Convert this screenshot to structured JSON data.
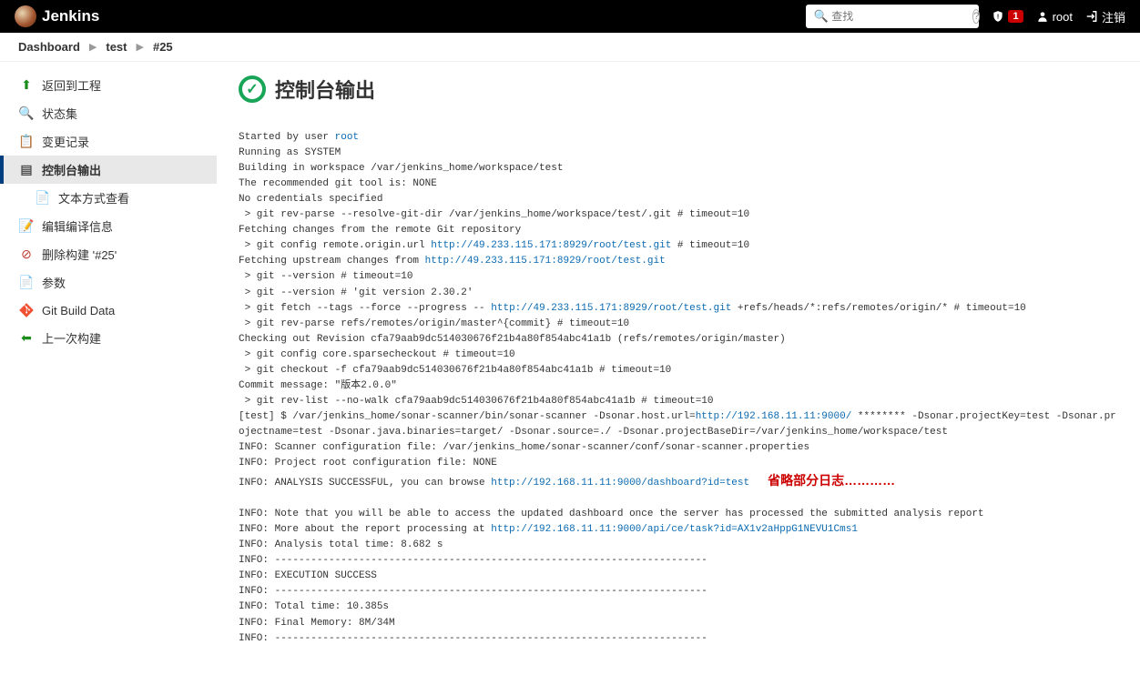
{
  "header": {
    "brand": "Jenkins",
    "searchPlaceholder": "查找",
    "alertCount": "1",
    "user": "root",
    "logoutLabel": "注销"
  },
  "breadcrumb": {
    "items": [
      "Dashboard",
      "test",
      "#25"
    ]
  },
  "sidebar": {
    "items": [
      {
        "key": "back",
        "label": "返回到工程"
      },
      {
        "key": "status",
        "label": "状态集"
      },
      {
        "key": "changes",
        "label": "变更记录"
      },
      {
        "key": "console",
        "label": "控制台输出"
      },
      {
        "key": "plaintext",
        "label": "文本方式查看"
      },
      {
        "key": "editinfo",
        "label": "编辑编译信息"
      },
      {
        "key": "delete",
        "label": "删除构建 '#25'"
      },
      {
        "key": "params",
        "label": "参数"
      },
      {
        "key": "git",
        "label": "Git Build Data"
      },
      {
        "key": "prev",
        "label": "上一次构建"
      }
    ]
  },
  "page": {
    "title": "控制台输出"
  },
  "links": {
    "user": "root",
    "url1": "http://49.233.115.171:8929/root/test.git",
    "url2": "http://49.233.115.171:8929/root/test.git",
    "url3": "http://49.233.115.171:8929/root/test.git",
    "sonarHost": "http://192.168.11.11:9000/",
    "dash": "http://192.168.11.11:9000/dashboard?id=test",
    "task": "http://192.168.11.11:9000/api/ce/task?id=AX1v2aHppG1NEVU1Cms1"
  },
  "annotation": "省略部分日志…………",
  "console": {
    "l01": "Started by user ",
    "l02": "Running as SYSTEM",
    "l03": "Building in workspace /var/jenkins_home/workspace/test",
    "l04": "The recommended git tool is: NONE",
    "l05": "No credentials specified",
    "l06": " > git rev-parse --resolve-git-dir /var/jenkins_home/workspace/test/.git # timeout=10",
    "l07": "Fetching changes from the remote Git repository",
    "l08a": " > git config remote.origin.url ",
    "l08b": " # timeout=10",
    "l09": "Fetching upstream changes from ",
    "l10": " > git --version # timeout=10",
    "l11": " > git --version # 'git version 2.30.2'",
    "l12a": " > git fetch --tags --force --progress -- ",
    "l12b": " +refs/heads/*:refs/remotes/origin/* # timeout=10",
    "l13": " > git rev-parse refs/remotes/origin/master^{commit} # timeout=10",
    "l14": "Checking out Revision cfa79aab9dc514030676f21b4a80f854abc41a1b (refs/remotes/origin/master)",
    "l15": " > git config core.sparsecheckout # timeout=10",
    "l16": " > git checkout -f cfa79aab9dc514030676f21b4a80f854abc41a1b # timeout=10",
    "l17": "Commit message: \"版本2.0.0\"",
    "l18": " > git rev-list --no-walk cfa79aab9dc514030676f21b4a80f854abc41a1b # timeout=10",
    "l19a": "[test] $ /var/jenkins_home/sonar-scanner/bin/sonar-scanner -Dsonar.host.url=",
    "l19b": " ******** -Dsonar.projectKey=test -Dsonar.projectname=test -Dsonar.java.binaries=target/ -Dsonar.source=./ -Dsonar.projectBaseDir=/var/jenkins_home/workspace/test",
    "l20": "INFO: Scanner configuration file: /var/jenkins_home/sonar-scanner/conf/sonar-scanner.properties",
    "l21": "INFO: Project root configuration file: NONE",
    "l22": "INFO: ANALYSIS SUCCESSFUL, you can browse ",
    "l23": "INFO: Note that you will be able to access the updated dashboard once the server has processed the submitted analysis report",
    "l24": "INFO: More about the report processing at ",
    "l25": "INFO: Analysis total time: 8.682 s",
    "l26": "INFO: ------------------------------------------------------------------------",
    "l27": "INFO: EXECUTION SUCCESS",
    "l28": "INFO: ------------------------------------------------------------------------",
    "l29": "INFO: Total time: 10.385s",
    "l30": "INFO: Final Memory: 8M/34M",
    "l31": "INFO: ------------------------------------------------------------------------"
  }
}
